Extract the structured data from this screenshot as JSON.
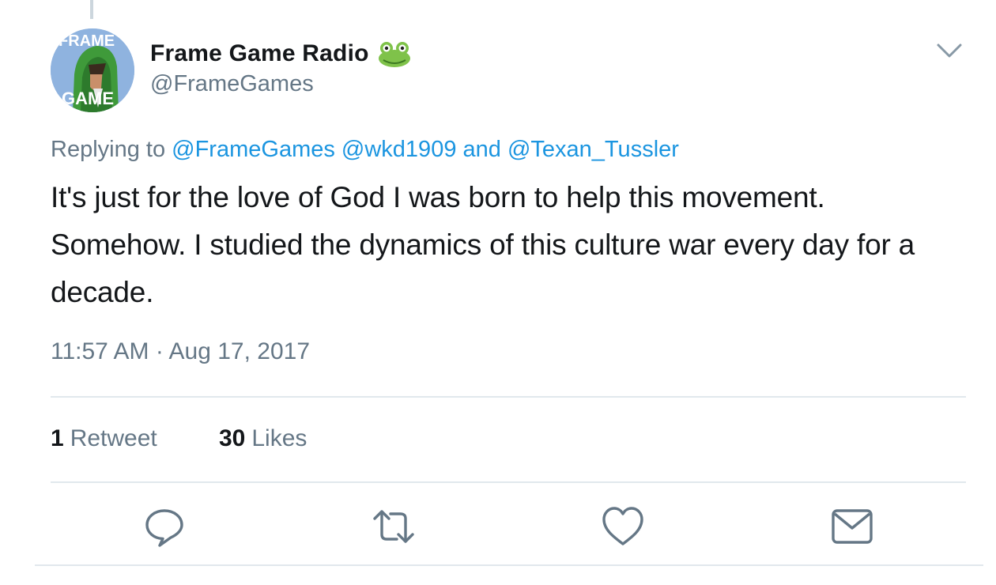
{
  "user": {
    "display_name": "Frame Game Radio",
    "handle": "@FrameGames",
    "avatar_text_top": "FRAME",
    "avatar_text_bottom": "GAME",
    "name_emoji": "frog-emoji"
  },
  "reply": {
    "prefix": "Replying to",
    "mentions": [
      "@FrameGames",
      "@wkd1909"
    ],
    "conjunction": "and",
    "last_mention": "@Texan_Tussler"
  },
  "tweet": {
    "text": "It's just for the love of God I was born to help this movement. Somehow. I studied the dynamics of this culture war every day for a decade."
  },
  "timestamp": "11:57 AM · Aug 17, 2017",
  "stats": {
    "retweets_count": "1",
    "retweets_label": "Retweet",
    "likes_count": "30",
    "likes_label": "Likes"
  },
  "actions": [
    "reply-icon",
    "retweet-icon",
    "like-icon",
    "share-icon"
  ],
  "colors": {
    "link": "#1b95e0",
    "secondary_text": "#657786",
    "primary_text": "#14171a",
    "divider": "#e1e8ed"
  }
}
